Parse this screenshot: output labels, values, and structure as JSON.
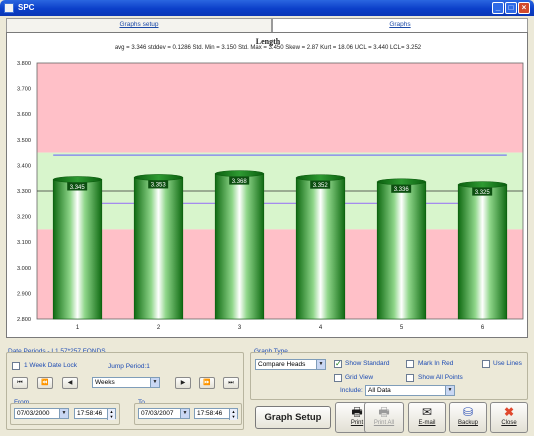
{
  "window": {
    "title": "SPC"
  },
  "tabs": [
    {
      "label": "Graphs setup"
    },
    {
      "label": "Graphs"
    }
  ],
  "chart_data": {
    "type": "bar",
    "title": "Length",
    "subtitle": "avg = 3.346  stddev = 0.1286  Std. Min = 3.150  Std. Max = 3.450  Skew = 2.87  Kurt = 18.06  UCL = 3.440  LCL= 3.252",
    "categories": [
      "1",
      "2",
      "3",
      "4",
      "5",
      "6"
    ],
    "values": [
      3.345,
      3.353,
      3.368,
      3.352,
      3.336,
      3.325
    ],
    "value_labels": [
      "3.345",
      "3.353",
      "3.368",
      "3.352",
      "3.336",
      "3.325"
    ],
    "yticks": [
      "2.800",
      "2.900",
      "3.000",
      "3.100",
      "3.200",
      "3.300",
      "3.400",
      "3.500",
      "3.600",
      "3.700",
      "3.800"
    ],
    "ylim": [
      2.8,
      3.8
    ],
    "bands": [
      {
        "from": 3.45,
        "to": 3.8,
        "color": "#ffc0c8"
      },
      {
        "from": 3.15,
        "to": 3.45,
        "color": "#d8f5cc"
      },
      {
        "from": 2.8,
        "to": 3.15,
        "color": "#ffc0c8"
      }
    ],
    "reference_lines": [
      {
        "value": 3.44,
        "color": "#7c7cf2"
      },
      {
        "value": 3.252,
        "color": "#9d7cf2"
      },
      {
        "value": 3.3,
        "color": "#333333"
      }
    ],
    "bar_color": "#1e8a1e",
    "grid": false
  },
  "date_periods": {
    "title": "Date Periods - L1  57*257 FONDS",
    "week_lock_label": "1 Week Date Lock",
    "jump_label": "Jump Period:1",
    "period_unit": "Weeks",
    "from_label": "From",
    "from_date": "07/03/2000",
    "from_time": "17:58:46",
    "to_label": "To",
    "to_date": "07/03/2007",
    "to_time": "17:58:46",
    "nav_first": "⏮",
    "nav_prev2": "⏪",
    "nav_prev": "◀",
    "nav_next": "▶",
    "nav_next2": "⏩",
    "nav_last": "⏭"
  },
  "graph_type": {
    "title": "Graph Type",
    "selected": "Compare Heads",
    "show_standard": "Show Standard",
    "grid_view": "Grid View",
    "mark_in_red": "Mark In Red",
    "show_all_points": "Show All Points",
    "use_lines": "Use Lines",
    "include_label": "Include:",
    "include_value": "All Data"
  },
  "buttons": {
    "graph_setup": "Graph Setup",
    "print": "Print",
    "print_all": "Print All",
    "email": "E-mail",
    "backup": "Backup",
    "close": "Close"
  }
}
